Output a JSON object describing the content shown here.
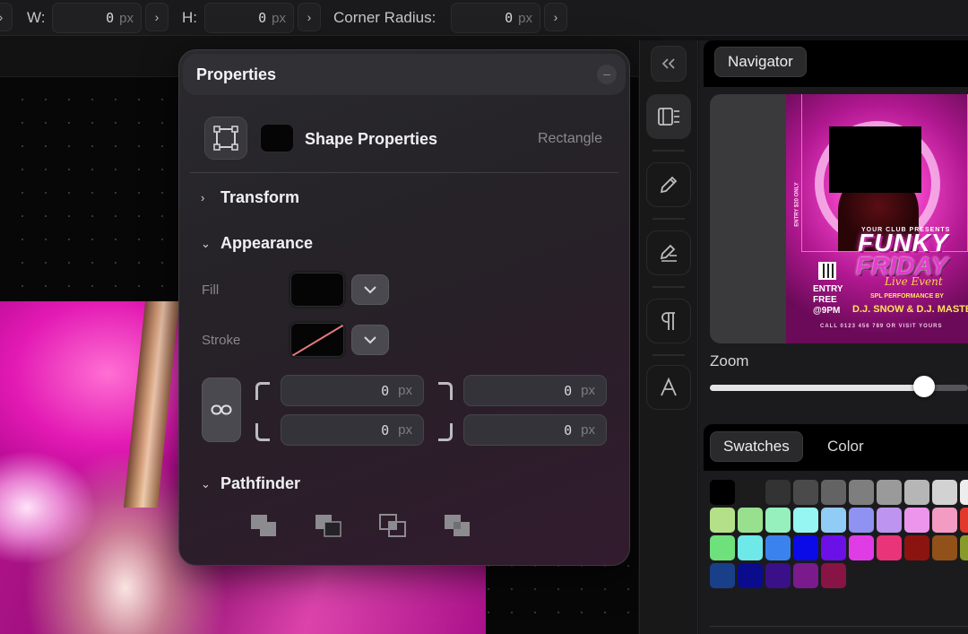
{
  "toolbar": {
    "width_label": "W:",
    "width_value": "0",
    "height_label": "H:",
    "height_value": "0",
    "radius_label": "Corner Radius:",
    "radius_value": "0",
    "unit": "px"
  },
  "properties": {
    "title": "Properties",
    "minimize_glyph": "–",
    "shape_title": "Shape Properties",
    "shape_type": "Rectangle",
    "sections": {
      "transform": "Transform",
      "appearance": "Appearance",
      "pathfinder": "Pathfinder"
    },
    "fill_label": "Fill",
    "stroke_label": "Stroke",
    "fill_color": "#050505",
    "stroke_color": "#050505",
    "corners": {
      "top_left": "0",
      "top_right": "0",
      "bottom_left": "0",
      "bottom_right": "0",
      "unit": "px"
    },
    "pathfinder_icons": [
      "unite-icon",
      "minus-front-icon",
      "intersect-icon",
      "exclude-icon"
    ]
  },
  "toolstrip": {
    "icons": [
      "collapse-panel-icon",
      "layers-panel-icon",
      "pencil-icon",
      "edit-text-icon",
      "paragraph-icon",
      "character-icon"
    ]
  },
  "navigator": {
    "tab_label": "Navigator",
    "flyer": {
      "presents": "YOUR CLUB PRESENTS",
      "side_text": "ENTRY $20 ONLY",
      "title_1": "FUNKY",
      "title_2": "FRIDAY",
      "subtitle": "Live Event",
      "entry": "ENTRY",
      "free": "FREE",
      "time": "@9PM",
      "performance": "SPL PERFORMANCE BY",
      "artists": "D.J. SNOW & D.J. MASTER",
      "footer": "CALL 0123 456 789 OR VISIT YOURS"
    },
    "zoom_label": "Zoom",
    "zoom_level": 0.83
  },
  "swatches": {
    "tabs": [
      "Swatches",
      "Color"
    ],
    "active_tab": "Swatches",
    "rows": [
      [
        "#000000",
        "#1c1c1c",
        "#333333",
        "#4a4a4a",
        "#636363",
        "#7e7e7e",
        "#9a9a9a",
        "#b6b6b6",
        "#d2d2d2",
        "#ededed"
      ],
      [
        "#b5e08a",
        "#99e08e",
        "#96f0bd",
        "#96f6f2",
        "#90ccf5",
        "#8f92f0",
        "#bd95f0",
        "#ed95ec",
        "#f39bc2",
        "#e2382c"
      ],
      [
        "#6ee07c",
        "#6ee8e8",
        "#3a83ee",
        "#0b0be8",
        "#6b10e6",
        "#e03ce6",
        "#e93479",
        "#8c1410",
        "#925119",
        "#8a9a2a"
      ],
      [
        "#1a3f89",
        "#0b0b8e",
        "#3a1088",
        "#7a1a8c",
        "#871444"
      ]
    ]
  }
}
